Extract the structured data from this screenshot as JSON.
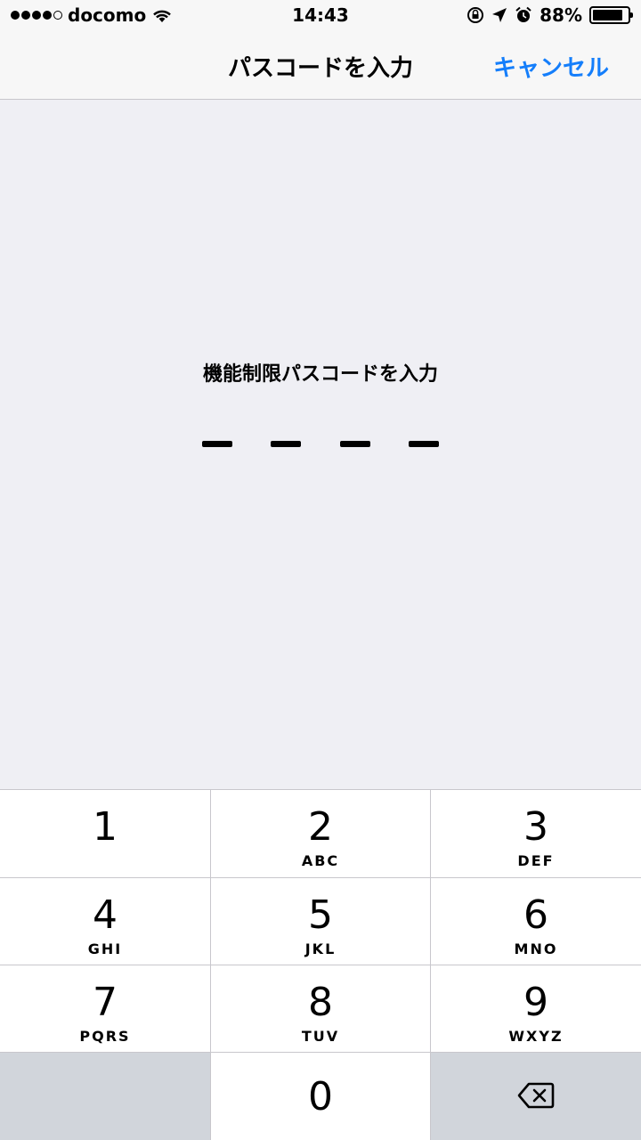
{
  "status": {
    "carrier": "docomo",
    "time": "14:43",
    "battery_percent": "88%",
    "battery_level": 0.88,
    "icons": [
      "signal-dots-icon",
      "wifi-icon",
      "rotation-lock-icon",
      "location-icon",
      "alarm-icon",
      "battery-icon"
    ]
  },
  "nav": {
    "title": "パスコードを入力",
    "cancel_label": "キャンセル",
    "accent_color": "#147efb"
  },
  "prompt": {
    "text": "機能制限パスコードを入力",
    "digits_entered": 0,
    "digits_total": 4
  },
  "keypad": {
    "keys": [
      {
        "digit": "1",
        "letters": ""
      },
      {
        "digit": "2",
        "letters": "ABC"
      },
      {
        "digit": "3",
        "letters": "DEF"
      },
      {
        "digit": "4",
        "letters": "GHI"
      },
      {
        "digit": "5",
        "letters": "JKL"
      },
      {
        "digit": "6",
        "letters": "MNO"
      },
      {
        "digit": "7",
        "letters": "PQRS"
      },
      {
        "digit": "8",
        "letters": "TUV"
      },
      {
        "digit": "9",
        "letters": "WXYZ"
      },
      {
        "digit": "0",
        "letters": ""
      }
    ],
    "delete_icon": "backspace-icon"
  }
}
